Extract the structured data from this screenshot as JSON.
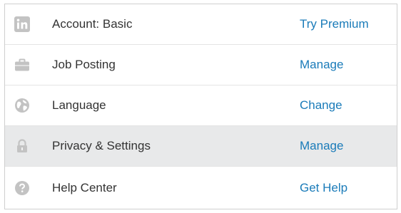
{
  "menu": {
    "items": [
      {
        "icon": "linkedin-icon",
        "label": "Account: Basic",
        "action": "Try Premium"
      },
      {
        "icon": "briefcase-icon",
        "label": "Job Posting",
        "action": "Manage"
      },
      {
        "icon": "globe-icon",
        "label": "Language",
        "action": "Change"
      },
      {
        "icon": "lock-icon",
        "label": "Privacy & Settings",
        "action": "Manage",
        "highlighted": true
      },
      {
        "icon": "help-icon",
        "label": "Help Center",
        "action": "Get Help"
      }
    ]
  },
  "colors": {
    "icon_gray": "#c3c3c3",
    "link_blue": "#1a7bb9",
    "highlight_bg": "#e8e9ea",
    "text": "#333333"
  }
}
